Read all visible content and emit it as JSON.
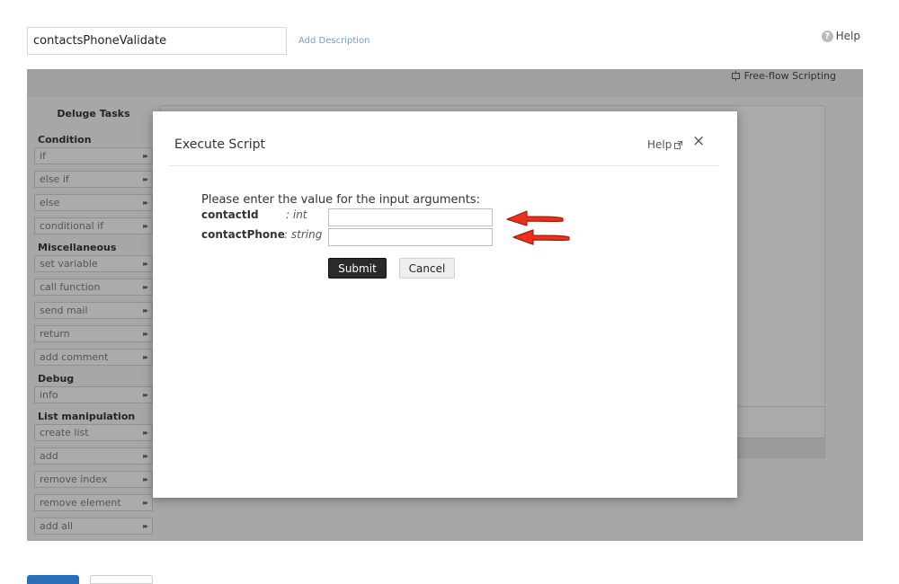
{
  "header": {
    "function_name": "contactsPhoneValidate",
    "add_description": "Add Description",
    "help": "Help",
    "help_icon": "?"
  },
  "toolbar": {
    "free_flow": "Free-flow Scripting"
  },
  "sidebar": {
    "title": "Deluge Tasks",
    "sections": [
      {
        "heading": "Condition",
        "items": [
          "if",
          "else if",
          "else",
          "conditional if"
        ]
      },
      {
        "heading": "Miscellaneous",
        "items": [
          "set variable",
          "call function",
          "send mail",
          "return",
          "add comment"
        ]
      },
      {
        "heading": "Debug",
        "items": [
          "info"
        ]
      },
      {
        "heading": "List manipulation",
        "items": [
          "create list",
          "add",
          "remove index",
          "remove element",
          "add all"
        ]
      }
    ],
    "item_arrow": "▸▸"
  },
  "dialog": {
    "title": "Execute Script",
    "help": "Help",
    "close": "×",
    "prompt": "Please enter the value for the input arguments:",
    "args": [
      {
        "name": "contactId",
        "type": ": int",
        "value": ""
      },
      {
        "name": "contactPhone",
        "type": ": string",
        "value": ""
      }
    ],
    "submit": "Submit",
    "cancel": "Cancel"
  },
  "colors": {
    "annotation_arrow": "#e8321c",
    "link": "#6a9fd8",
    "submit_bg": "#2a2a2a"
  },
  "icons": {
    "help": "question-circle-icon",
    "free_flow": "script-icon",
    "help_external": "external-link-icon",
    "close": "close-icon",
    "annotation": "red-arrow-icon"
  }
}
